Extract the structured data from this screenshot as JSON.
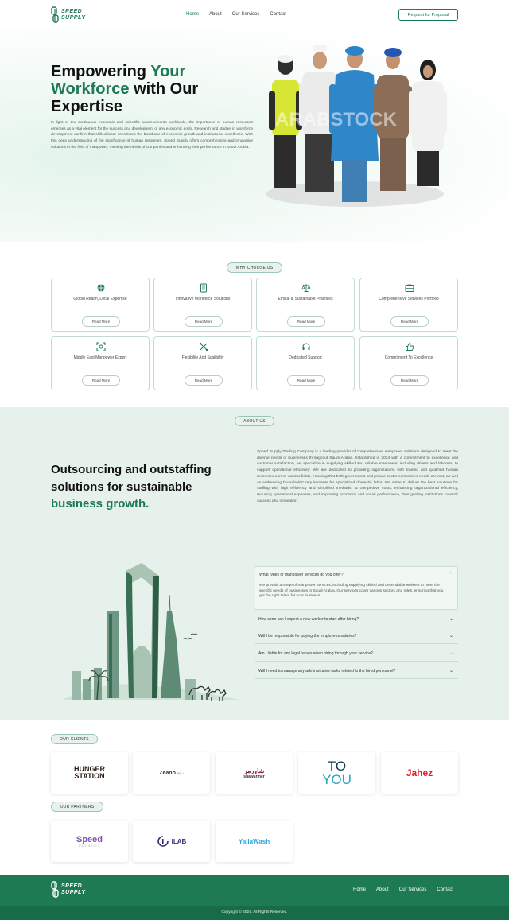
{
  "brand": {
    "line1": "SPEED",
    "line2": "SUPPLY",
    "color": "#1e7a52"
  },
  "nav": {
    "items": [
      "Home",
      "About",
      "Our Services",
      "Contact"
    ],
    "active": "Home"
  },
  "header": {
    "cta": "Request for Proposal"
  },
  "hero": {
    "title_part1": "Empowering ",
    "title_highlight": "Your Workforce",
    "title_part2": " with Our Expertise",
    "description": "In light of the continuous economic and scientific advancements worldwide, the importance of human resources emerges as a vital element for the success and development of any economic entity. Research and studies in workforce development confirm that skilled labor constitutes the backbone of economic growth and institutional excellence. With this deep understanding of the significance of human resources, Speed Supply offers comprehensive and innovative solutions in the field of manpower, meeting the needs of companies and enhancing their performance in Saudi Arabia.",
    "watermark": "ARABSTOCK"
  },
  "why": {
    "label": "WHY CHOOSE US",
    "cards": [
      {
        "title": "Global Reach, Local Expertise",
        "icon": "globe-icon",
        "button": "Read More"
      },
      {
        "title": "Innovative Workforce Solutions",
        "icon": "document-icon",
        "button": "Read More"
      },
      {
        "title": "Ethical & Sustainable Practices",
        "icon": "scale-icon",
        "button": "Read More"
      },
      {
        "title": "Comprehensive Services Portfolio",
        "icon": "briefcase-icon",
        "button": "Read More"
      },
      {
        "title": "Middle East Manpower Expert",
        "icon": "focus-icon",
        "button": "Read More"
      },
      {
        "title": "Flexibility And Scalibility",
        "icon": "arrows-icon",
        "button": "Read More"
      },
      {
        "title": "Dedicated Support",
        "icon": "support-icon",
        "button": "Read More"
      },
      {
        "title": "Commitment To Excellence",
        "icon": "thumbs-up-icon",
        "button": "Read More"
      }
    ]
  },
  "about": {
    "label": "ABOUT US",
    "title_part1": "Outsourcing and outstaffing solutions for sustainable ",
    "title_highlight": "business growth.",
    "description": "Speed Supply Trading Company is a leading provider of comprehensive manpower solutions designed to meet the diverse needs of businesses throughout Saudi Arabia. Established in 2024 with a commitment to excellence and customer satisfaction, we specialize in supplying skilled and reliable manpower, including drivers and laborers, to support operational efficiency. We are dedicated to providing organizations with trained and qualified human resources across various fields, ensuring that both government and private sector companies' needs are met, as well as addressing households' requirements for specialized domestic labor. We strive to deliver the best solutions for staffing with high efficiency and simplified methods, at competitive costs, enhancing organizational efficiency, reducing operational expenses, and improving economic and social performance, thus guiding institutions towards success and innovation."
  },
  "faq": {
    "open_question": "What types of manpower services do you offer?",
    "open_answer": "We provide a range of manpower services, including supplying skilled and dependable workers to meet the specific needs of businesses in Saudi Arabia. Our services cover various sectors and roles, ensuring that you get the right talent for your business.",
    "questions": [
      "How soon can I expect a new worker to start after hiring?",
      "Will I be responsible for paying the employees salaries?",
      "Am I liable for any legal issues when hiring through your service?",
      "Will I need to manage any administrative tasks related to the hired personnel?"
    ]
  },
  "clients": {
    "label": "OUR CLIENTS",
    "logos": [
      {
        "line1": "HUNGER",
        "line2": "STATION"
      },
      {
        "main": "Zeano",
        "sub": "رينو"
      },
      {
        "ar": "شاورمر",
        "en": "shawarmer"
      },
      {
        "line1": "TO",
        "line2": "YOU"
      },
      {
        "main": "Jahez"
      }
    ]
  },
  "partners": {
    "label": "OUR PARTNERS",
    "logos": [
      {
        "main": "Speed",
        "sub": "LOGISTICS"
      },
      {
        "main": "ILAB"
      },
      {
        "main": "YallaWash"
      }
    ]
  },
  "footer": {
    "nav": [
      "Home",
      "About",
      "Our Services",
      "Contact"
    ],
    "copyright": "Copyright © 2024. All Rights Reserved."
  }
}
